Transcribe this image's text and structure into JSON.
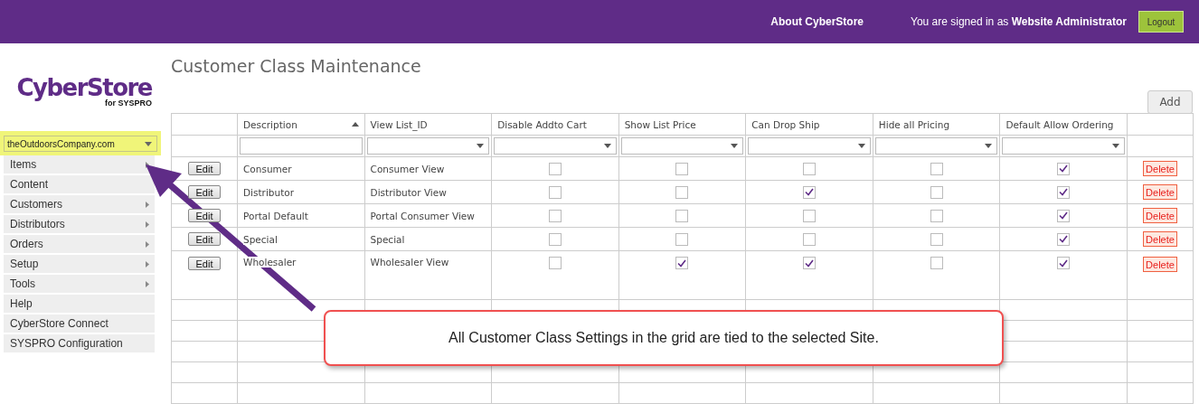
{
  "topbar": {
    "about_link": "About CyberStore",
    "signed_in": "You are signed in as **Website Administrator**",
    "logout_button": "Logout"
  },
  "logo": {
    "name": "CyberStore",
    "tagline": "for SYSPRO"
  },
  "site_selector": {
    "value": "theOutdoorsCompany.com"
  },
  "sidebar": {
    "items": [
      {
        "label": "Items",
        "has_submenu": true
      },
      {
        "label": "Content",
        "has_submenu": false
      },
      {
        "label": "Customers",
        "has_submenu": true
      },
      {
        "label": "Distributors",
        "has_submenu": true
      },
      {
        "label": "Orders",
        "has_submenu": true
      },
      {
        "label": "Setup",
        "has_submenu": true
      },
      {
        "label": "Tools",
        "has_submenu": true
      },
      {
        "label": "Help",
        "has_submenu": false
      },
      {
        "label": "CyberStore Connect",
        "has_submenu": false
      },
      {
        "label": "SYSPRO Configuration",
        "has_submenu": false
      }
    ]
  },
  "page_title": "Customer Class Maintenance",
  "add_button": "Add",
  "table": {
    "columns": [
      {
        "label": "Description",
        "kind": "text",
        "sorted": true
      },
      {
        "label": "View List_ID",
        "kind": "dropdown",
        "sorted": false
      },
      {
        "label": "Disable Addto Cart",
        "kind": "dropdown",
        "sorted": false
      },
      {
        "label": "Show List Price",
        "kind": "dropdown",
        "sorted": false
      },
      {
        "label": "Can Drop Ship",
        "kind": "dropdown",
        "sorted": false
      },
      {
        "label": "Hide all Pricing",
        "kind": "dropdown",
        "sorted": false
      },
      {
        "label": "Default Allow Ordering",
        "kind": "dropdown",
        "sorted": false
      }
    ],
    "rows": [
      {
        "edit": "Edit",
        "description": "Consumer",
        "view_list": "Consumer View",
        "flags": [
          false,
          false,
          false,
          false,
          true
        ],
        "delete": "Delete"
      },
      {
        "edit": "Edit",
        "description": "Distributor",
        "view_list": "Distributor View",
        "flags": [
          false,
          false,
          true,
          false,
          true
        ],
        "delete": "Delete"
      },
      {
        "edit": "Edit",
        "description": "Portal Default",
        "view_list": "Portal Consumer View",
        "flags": [
          false,
          false,
          false,
          false,
          true
        ],
        "delete": "Delete"
      },
      {
        "edit": "Edit",
        "description": "Special",
        "view_list": "Special",
        "flags": [
          false,
          false,
          false,
          false,
          true
        ],
        "delete": "Delete"
      },
      {
        "edit": "Edit",
        "description": "Wholesaler",
        "view_list": "Wholesaler View",
        "flags": [
          false,
          true,
          true,
          false,
          true
        ],
        "delete": "Delete"
      }
    ]
  },
  "callout": {
    "text": "All Customer Class Settings in the grid are tied to the selected Site."
  }
}
